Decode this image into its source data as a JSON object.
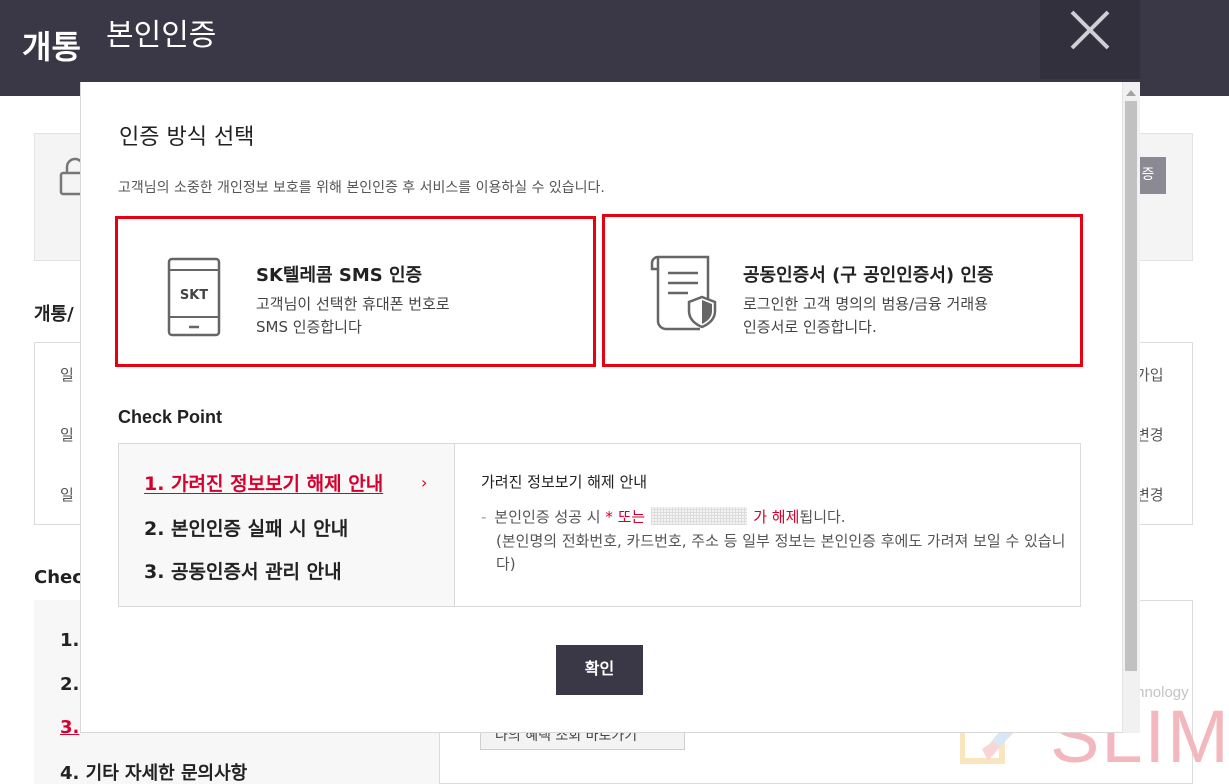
{
  "background": {
    "page_title": "개통",
    "card_button": "증",
    "section1_title": "개통/",
    "list_left": [
      "일",
      "일",
      "일"
    ],
    "list_right": [
      "가입",
      "변경",
      "변경"
    ],
    "section2_title": "Check",
    "checkpoint_items": [
      "1.",
      "2.",
      "3.",
      "4. 기타 자세한 문의사항"
    ],
    "small_button": "나의 혜택 조회 바로가기"
  },
  "watermark": {
    "top": "Internet Technology",
    "brand": "SLIM"
  },
  "modal": {
    "title": "본인인증",
    "close_label": "×",
    "select_title": "인증 방식 선택",
    "select_desc": "고객님의 소중한 개인정보 보호를 위해 본인인증 후 서비스를 이용하실 수 있습니다.",
    "options": [
      {
        "icon": "skt-phone-icon",
        "icon_text": "SKT",
        "title": "SK텔레콤 SMS 인증",
        "desc_line1": "고객님이 선택한 휴대폰 번호로",
        "desc_line2": "SMS 인증합니다"
      },
      {
        "icon": "certificate-icon",
        "title": "공동인증서 (구 공인인증서) 인증",
        "desc_line1": "로그인한 고객 명의의 범용/금융 거래용",
        "desc_line2": "인증서로 인증합니다."
      }
    ],
    "checkpoint": {
      "title": "Check Point",
      "items": [
        "1. 가려진 정보보기 해제 안내",
        "2. 본인인증 실패 시 안내",
        "3. 공동인증서 관리 안내"
      ],
      "active_index": 0,
      "arrow": "›",
      "detail_title": "가려진 정보보기 해제 안내",
      "detail_dash": "-",
      "detail_l1_a": "본인인증 성공 시",
      "detail_l1_b": "* 또는",
      "detail_l1_c": "가 해제",
      "detail_l1_d": "됩니다.",
      "detail_l2": "(본인명의 전화번호, 카드번호, 주소 등 일부 정보는 본인인증 후에도 가려져 보일 수 있습니다)"
    },
    "ok_label": "확인"
  },
  "colors": {
    "header": "#3a3746",
    "accent_red": "#e60012",
    "link_red": "#d6002f"
  }
}
